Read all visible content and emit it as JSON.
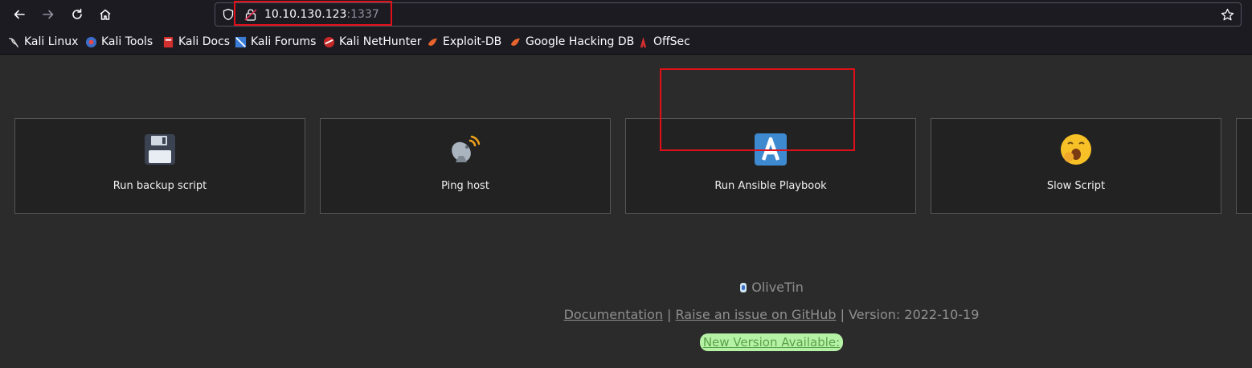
{
  "browser": {
    "url_host": "10.10.130.123",
    "url_port": ":1337",
    "bookmarks": [
      {
        "label": "Kali Linux",
        "icon": "kali-dragon-icon"
      },
      {
        "label": "Kali Tools",
        "icon": "kali-tools-icon"
      },
      {
        "label": "Kali Docs",
        "icon": "kali-docs-icon"
      },
      {
        "label": "Kali Forums",
        "icon": "kali-forums-icon"
      },
      {
        "label": "Kali NetHunter",
        "icon": "nethunter-icon"
      },
      {
        "label": "Exploit-DB",
        "icon": "exploit-db-icon"
      },
      {
        "label": "Google Hacking DB",
        "icon": "ghdb-icon"
      },
      {
        "label": "OffSec",
        "icon": "offsec-icon"
      }
    ]
  },
  "actions": [
    {
      "label": "Run backup script",
      "icon": "floppy-disk-icon"
    },
    {
      "label": "Ping host",
      "icon": "satellite-dish-icon"
    },
    {
      "label": "Run Ansible Playbook",
      "icon": "ansible-icon"
    },
    {
      "label": "Slow Script",
      "icon": "yawning-face-icon"
    }
  ],
  "footer": {
    "title": "OliveTin",
    "documentation": "Documentation",
    "separator": "|",
    "raise_issue": "Raise an issue on GitHub",
    "version": "Version: 2022-10-19",
    "new_version": "New Version Available:"
  },
  "colors": {
    "highlight": "#e0101a",
    "new_version_bg": "#b6f2a5"
  }
}
